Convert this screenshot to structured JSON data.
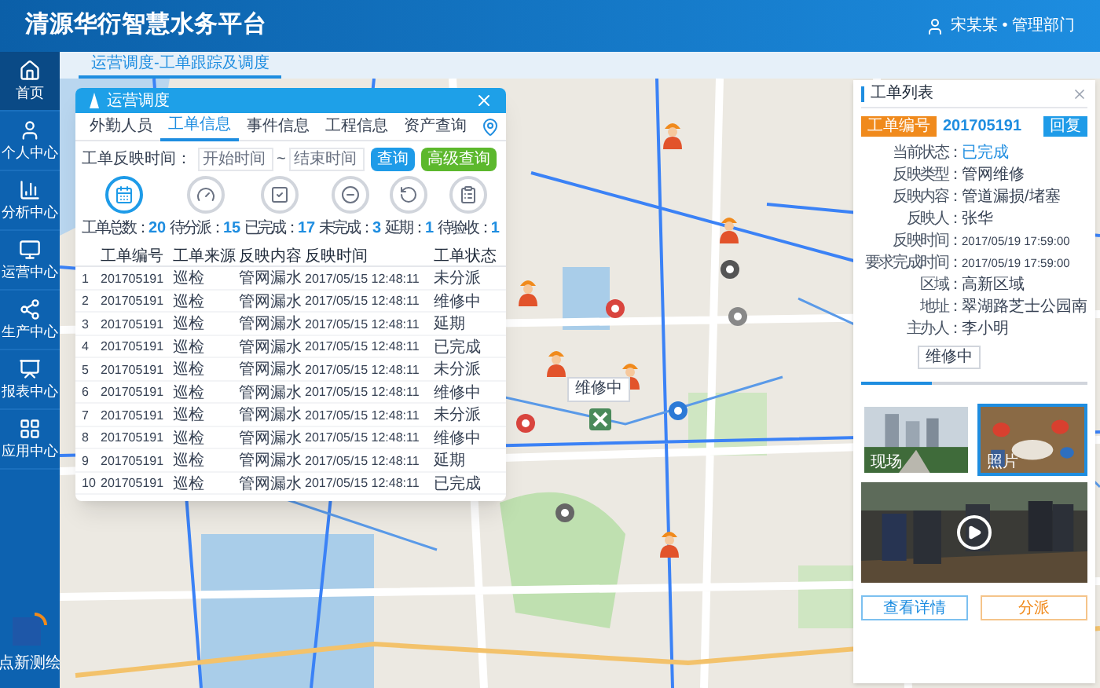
{
  "header": {
    "title": "清源华衍智慧水务平台",
    "user": "宋某某 • 管理部门"
  },
  "sidebar": {
    "items": [
      {
        "label": "首页",
        "selected": true
      },
      {
        "label": "个人中心",
        "selected": false
      },
      {
        "label": "分析中心",
        "selected": false
      },
      {
        "label": "运营中心",
        "selected": false
      },
      {
        "label": "生产中心",
        "selected": false
      },
      {
        "label": "报表中心",
        "selected": false
      },
      {
        "label": "应用中心",
        "selected": false
      }
    ],
    "logo": "点新测绘"
  },
  "breadcrumb": "运营调度-工单跟踪及调度",
  "dispatch_dialog": {
    "title": "运营调度",
    "tabs": [
      {
        "label": "外勤人员",
        "selected": false
      },
      {
        "label": "工单信息",
        "selected": true
      },
      {
        "label": "事件信息",
        "selected": false
      },
      {
        "label": "工程信息",
        "selected": false
      },
      {
        "label": "资产查询",
        "selected": false
      }
    ],
    "filter": {
      "label": "工单反映时间：",
      "start_placeholder": "开始时间",
      "separator": "~",
      "end_placeholder": "结束时间",
      "search_button": "查询",
      "advanced_button": "高级查询"
    },
    "stats": [
      {
        "label": "工单总数：",
        "value": "20",
        "selected": true
      },
      {
        "label": "待分派：",
        "value": "15",
        "selected": false
      },
      {
        "label": "已完成：",
        "value": "17",
        "selected": false
      },
      {
        "label": "未完成：",
        "value": "3",
        "selected": false
      },
      {
        "label": "延期：",
        "value": "1",
        "selected": false
      },
      {
        "label": "待验收：",
        "value": "1",
        "selected": false
      }
    ],
    "table": {
      "columns": [
        "",
        "工单编号",
        "工单来源",
        "反映内容",
        "反映时间",
        "工单状态"
      ],
      "rows": [
        [
          "1",
          "201705191",
          "巡检",
          "管网漏水",
          "2017/05/15 12:48:11",
          "未分派"
        ],
        [
          "2",
          "201705191",
          "巡检",
          "管网漏水",
          "2017/05/15 12:48:11",
          "维修中"
        ],
        [
          "3",
          "201705191",
          "巡检",
          "管网漏水",
          "2017/05/15 12:48:11",
          "延期"
        ],
        [
          "4",
          "201705191",
          "巡检",
          "管网漏水",
          "2017/05/15 12:48:11",
          "已完成"
        ],
        [
          "5",
          "201705191",
          "巡检",
          "管网漏水",
          "2017/05/15 12:48:11",
          "未分派"
        ],
        [
          "6",
          "201705191",
          "巡检",
          "管网漏水",
          "2017/05/15 12:48:11",
          "维修中"
        ],
        [
          "7",
          "201705191",
          "巡检",
          "管网漏水",
          "2017/05/15 12:48:11",
          "未分派"
        ],
        [
          "8",
          "201705191",
          "巡检",
          "管网漏水",
          "2017/05/15 12:48:11",
          "维修中"
        ],
        [
          "9",
          "201705191",
          "巡检",
          "管网漏水",
          "2017/05/15 12:48:11",
          "延期"
        ],
        [
          "10",
          "201705191",
          "巡检",
          "管网漏水",
          "2017/05/15 12:48:11",
          "已完成"
        ]
      ]
    }
  },
  "map": {
    "callout": "维修中"
  },
  "work_order_panel": {
    "title": "工单列表",
    "order_label": "工单编号",
    "order_number": "201705191",
    "reply_button": "回复",
    "fields": [
      {
        "label": "当前状态：",
        "value": "已完成",
        "highlight": true,
        "kind": "text"
      },
      {
        "label": "反映类型：",
        "value": "管网维修",
        "highlight": false,
        "kind": "text"
      },
      {
        "label": "反映内容：",
        "value": "管道漏损/堵塞",
        "highlight": false,
        "kind": "text"
      },
      {
        "label": "反映人：",
        "value": "张华",
        "highlight": false,
        "kind": "text"
      },
      {
        "label": "反映时间：",
        "value": "2017/05/19 17:59:00",
        "highlight": false,
        "kind": "datetime"
      },
      {
        "label": "要求完成时间：",
        "value": "2017/05/19 17:59:00",
        "highlight": false,
        "kind": "datetime"
      },
      {
        "label": "区域：",
        "value": "高新区域",
        "highlight": false,
        "kind": "text"
      },
      {
        "label": "地址：",
        "value": "翠湖路芝士公园南",
        "highlight": false,
        "kind": "text"
      },
      {
        "label": "主办人：",
        "value": "李小明",
        "highlight": false,
        "kind": "text"
      }
    ],
    "progress": {
      "label": "维修中",
      "level": 0.31
    },
    "photos": [
      {
        "label": "现场",
        "selected": false
      },
      {
        "label": "照片",
        "selected": true
      }
    ],
    "details_button": "查看详情",
    "assign_button": "分派"
  }
}
